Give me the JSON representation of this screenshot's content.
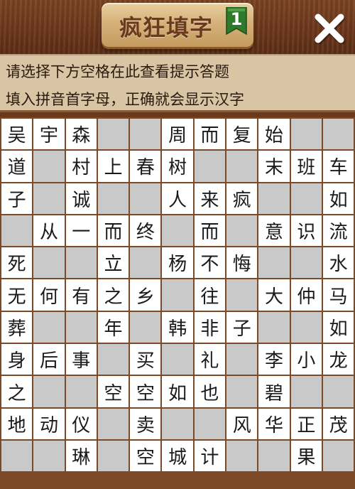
{
  "header": {
    "title": "疯狂填字",
    "level": "1",
    "close_icon": "close-x-icon"
  },
  "hint_panel": {
    "line1": "请选择下方空格在此查看提示答题",
    "line2": "填入拼音首字母，正确就会显示汉字"
  },
  "colors": {
    "wood": "#6b3a1c",
    "plaque": "#d6b27a",
    "hint_bg": "#d9c4a4",
    "empty_cell": "#c9c9c9",
    "filled_cell": "#ffffff",
    "flag_green": "#2f7a2a"
  },
  "grid": {
    "rows": [
      [
        "吴",
        "宇",
        "森",
        "",
        "",
        "周",
        "而",
        "复",
        "始",
        "",
        ""
      ],
      [
        "道",
        "",
        "村",
        "上",
        "春",
        "树",
        "",
        "",
        "末",
        "班",
        "车"
      ],
      [
        "子",
        "",
        "诚",
        "",
        "",
        "人",
        "来",
        "疯",
        "",
        "",
        "如"
      ],
      [
        "",
        "从",
        "一",
        "而",
        "终",
        "",
        "而",
        "",
        "意",
        "识",
        "流"
      ],
      [
        "死",
        "",
        "",
        "立",
        "",
        "杨",
        "不",
        "悔",
        "",
        "",
        "水"
      ],
      [
        "无",
        "何",
        "有",
        "之",
        "乡",
        "",
        "往",
        "",
        "大",
        "仲",
        "马"
      ],
      [
        "葬",
        "",
        "",
        "年",
        "",
        "韩",
        "非",
        "子",
        "",
        "",
        "如"
      ],
      [
        "身",
        "后",
        "事",
        "",
        "买",
        "",
        "礼",
        "",
        "李",
        "小",
        "龙"
      ],
      [
        "之",
        "",
        "",
        "空",
        "空",
        "如",
        "也",
        "",
        "碧",
        "",
        ""
      ],
      [
        "地",
        "动",
        "仪",
        "",
        "卖",
        "",
        "",
        "风",
        "华",
        "正",
        "茂"
      ],
      [
        "",
        "",
        "琳",
        "",
        "空",
        "城",
        "计",
        "",
        "",
        "果",
        ""
      ]
    ]
  }
}
